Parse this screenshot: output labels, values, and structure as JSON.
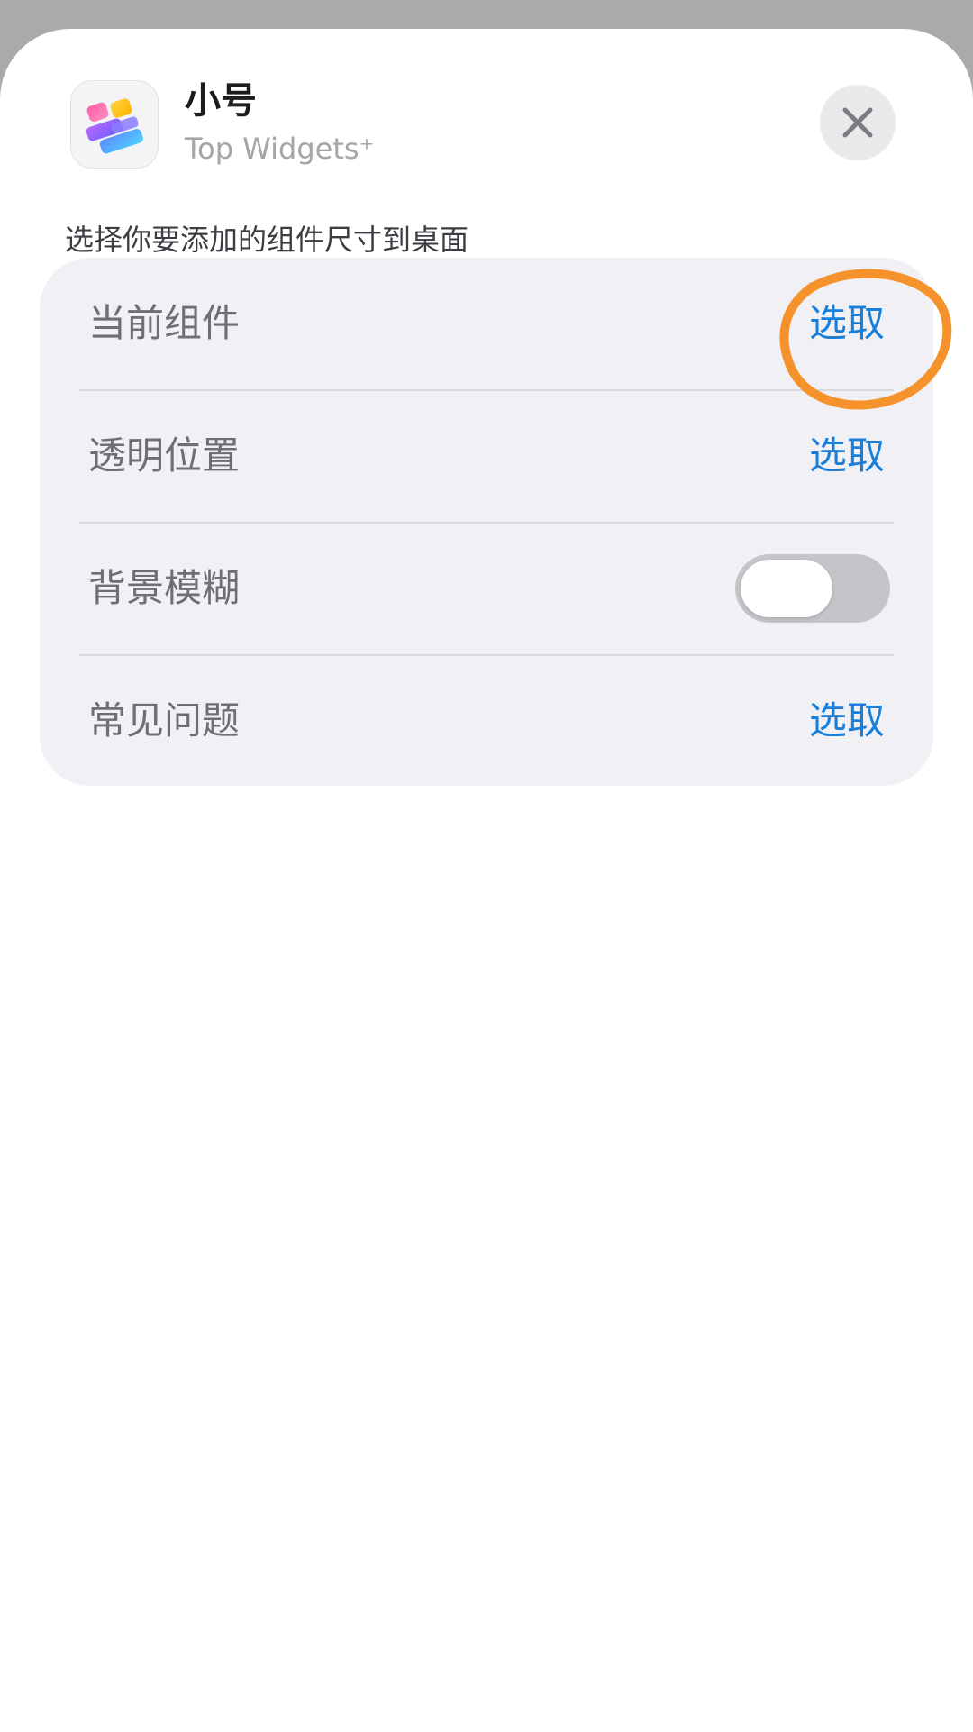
{
  "sheet": {
    "title": "小号",
    "app_name": "Top Widgets⁺",
    "subtitle": "选择你要添加的组件尺寸到桌面",
    "close_icon": "close-icon",
    "app_icon": "top-widgets-app-icon"
  },
  "options": [
    {
      "label": "当前组件",
      "action": "选取"
    },
    {
      "label": "透明位置",
      "action": "选取"
    },
    {
      "label": "背景模糊",
      "toggle": false
    },
    {
      "label": "常见问题",
      "action": "选取"
    }
  ],
  "annotation": {
    "type": "hand-drawn-circle",
    "target": "options.0.action",
    "color": "#f5922b"
  },
  "colors": {
    "accent": "#1a7fd9",
    "card_bg": "#f0f0f5",
    "toggle_off": "#c4c4c9",
    "dimmed_bg": "#a9aaac"
  }
}
